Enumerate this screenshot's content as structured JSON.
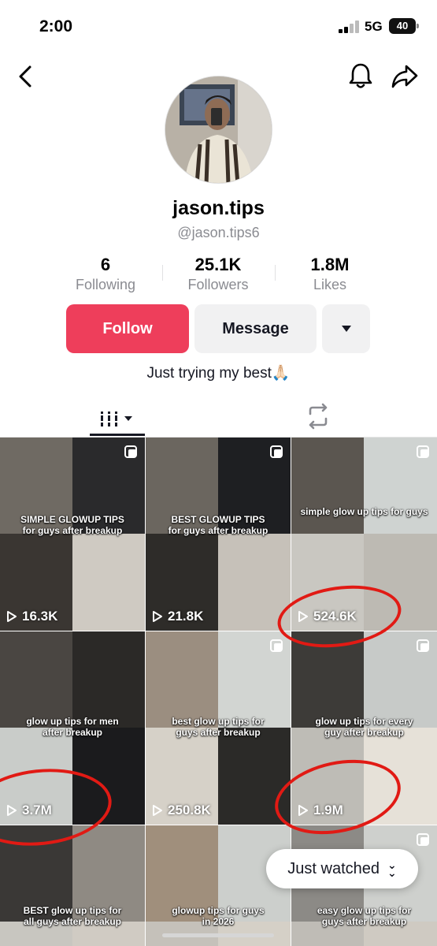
{
  "status_bar": {
    "time": "2:00",
    "network": "5G",
    "battery": "40"
  },
  "nav": {
    "back_icon": "chevron-left-icon",
    "bell_icon": "bell-icon",
    "share_icon": "share-arrow-icon"
  },
  "profile": {
    "display_name": "jason.tips",
    "handle": "@jason.tips6",
    "bio": "Just trying my best🙏🏻"
  },
  "stats": [
    {
      "value": "6",
      "label": "Following"
    },
    {
      "value": "25.1K",
      "label": "Followers"
    },
    {
      "value": "1.8M",
      "label": "Likes"
    }
  ],
  "actions": {
    "follow": "Follow",
    "message": "Message",
    "more_icon": "caret-down-icon"
  },
  "tabs": {
    "videos_icon": "grid-icon",
    "reposts_icon": "repost-icon"
  },
  "videos": [
    {
      "caption": "SIMPLE GLOWUP TIPS\nfor guys after breakup",
      "views": "16.3K"
    },
    {
      "caption": "BEST GLOWUP TIPS\nfor guys after breakup",
      "views": "21.8K"
    },
    {
      "caption": "simple glow up tips for guys",
      "views": "524.6K"
    },
    {
      "caption": "glow up tips for men\nafter breakup",
      "views": "3.7M"
    },
    {
      "caption": "best glow up tips for\nguys after breakup",
      "views": "250.8K"
    },
    {
      "caption": "glow up tips for every\nguy after breakup",
      "views": "1.9M"
    },
    {
      "caption": "BEST glow up tips for\nall guys after breakup",
      "views": ""
    },
    {
      "caption": "glowup tips for guys\nin 2026",
      "views": ""
    },
    {
      "caption": "easy glow up tips for\nguys after breakup",
      "views": ""
    }
  ],
  "just_watched": {
    "label": "Just watched",
    "icon": "double-chevron-down-icon"
  },
  "colors": {
    "follow_button": "#ee3e5b",
    "secondary_button": "#f1f1f2",
    "annotation_circle": "#e11a14",
    "muted_text": "#8a8b91"
  }
}
